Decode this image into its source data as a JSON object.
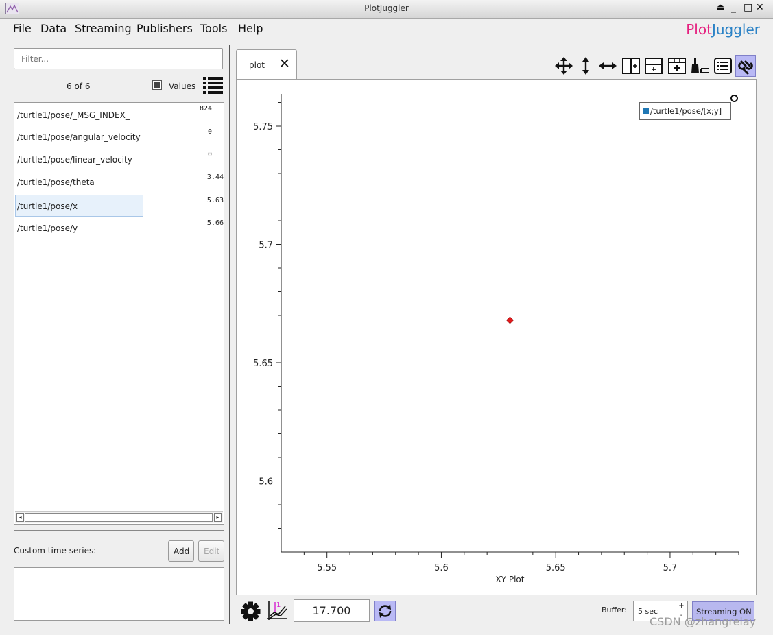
{
  "window": {
    "title": "PlotJuggler"
  },
  "menu": [
    "File",
    "Data",
    "Streaming",
    "Publishers",
    "Tools",
    "Help"
  ],
  "logo": {
    "part1": "Plot",
    "part2": "Juggler"
  },
  "left_panel": {
    "filter_placeholder": "Filter...",
    "count_label": "6 of 6",
    "values_label": "Values",
    "values_checked": true,
    "series": [
      {
        "name": "/turtle1/pose/_MSG_INDEX_",
        "value": "824"
      },
      {
        "name": "/turtle1/pose/angular_velocity",
        "value": "0"
      },
      {
        "name": "/turtle1/pose/linear_velocity",
        "value": "0"
      },
      {
        "name": "/turtle1/pose/theta",
        "value": "3.44"
      },
      {
        "name": "/turtle1/pose/x",
        "value": "5.63",
        "selected": true
      },
      {
        "name": "/turtle1/pose/y",
        "value": "5.66"
      }
    ],
    "custom_label": "Custom time series:",
    "add_label": "Add",
    "edit_label": "Edit"
  },
  "tab": {
    "label": "plot"
  },
  "toolbar_icons": [
    "move-icon",
    "zoom-vertical-icon",
    "zoom-horizontal-icon",
    "split-horizontal-icon",
    "split-vertical-icon",
    "add-plot-icon",
    "clear-icon",
    "legend-icon",
    "link-icon"
  ],
  "legend": {
    "label": "/turtle1/pose/[x;y]",
    "color": "#1f77b4"
  },
  "chart_data": {
    "type": "scatter",
    "title": "",
    "xlabel": "XY Plot",
    "ylabel": "",
    "xlim": [
      5.53,
      5.73
    ],
    "ylim": [
      5.57,
      5.77
    ],
    "xticks": [
      5.55,
      5.6,
      5.65,
      5.7
    ],
    "xtick_labels": [
      "5.55",
      "5.6",
      "5.65",
      "5.7"
    ],
    "yticks": [
      5.6,
      5.65,
      5.7,
      5.75
    ],
    "ytick_labels": [
      "5.6",
      "5.65",
      "5.7",
      "5.75"
    ],
    "series": [
      {
        "name": "/turtle1/pose/[x;y]",
        "color": "#e31a1c",
        "x": [
          5.63
        ],
        "y": [
          5.668
        ]
      }
    ],
    "grid": false,
    "legend_position": "top-right"
  },
  "bottom": {
    "time": "17.700",
    "buffer_label": "Buffer:",
    "buffer_value": "5 sec",
    "streaming_label": "Streaming ON"
  },
  "watermark": "CSDN @zhangrelay"
}
